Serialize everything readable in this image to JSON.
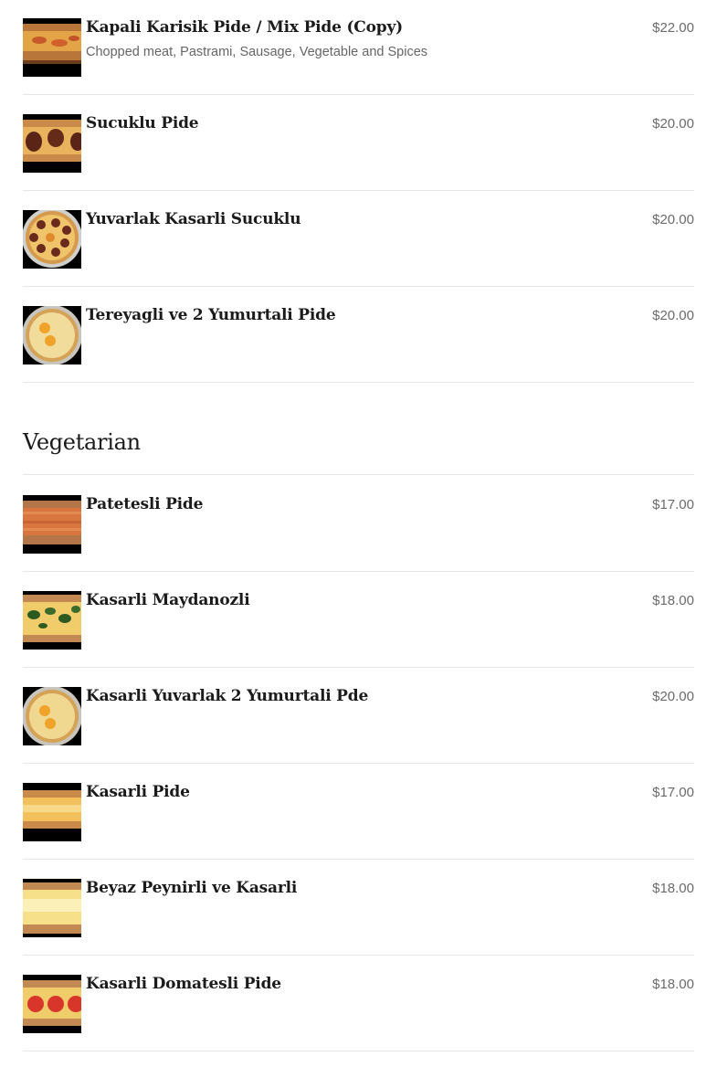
{
  "items_top": [
    {
      "name": "Kapali Karisik Pide / Mix Pide (Copy)",
      "description": "Chopped meat, Pastrami, Sausage, Vegetable and Spices",
      "price": "$22.00",
      "image": "closed-pide-photo"
    },
    {
      "name": "Sucuklu Pide",
      "price": "$20.00",
      "image": "sucuk-pide-photo"
    },
    {
      "name": "Yuvarlak Kasarli Sucuklu",
      "price": "$20.00",
      "image": "round-sucuk-pide-photo"
    },
    {
      "name": "Tereyagli ve 2 Yumurtali Pide",
      "price": "$20.00",
      "image": "egg-pide-photo"
    }
  ],
  "section": {
    "title": "Vegetarian"
  },
  "items_vegetarian": [
    {
      "name": "Patetesli Pide",
      "price": "$17.00",
      "image": "potato-pide-photo"
    },
    {
      "name": "Kasarli Maydanozli",
      "price": "$18.00",
      "image": "parsley-pide-photo"
    },
    {
      "name": "Kasarli Yuvarlak 2 Yumurtali Pde",
      "price": "$20.00",
      "image": "round-egg-pide-photo"
    },
    {
      "name": "Kasarli Pide",
      "price": "$17.00",
      "image": "cheese-pide-photo"
    },
    {
      "name": "Beyaz Peynirli ve Kasarli",
      "price": "$18.00",
      "image": "white-cheese-pide-photo"
    },
    {
      "name": "Kasarli Domatesli Pide",
      "price": "$18.00",
      "image": "tomato-pide-photo"
    }
  ]
}
